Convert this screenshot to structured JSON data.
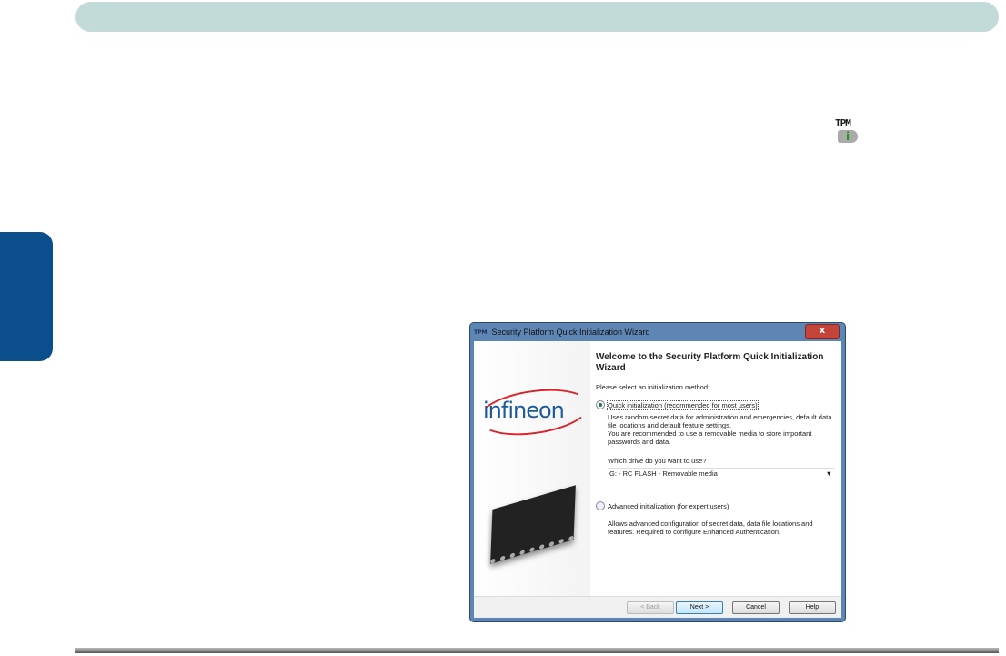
{
  "tpm_icon": {
    "label": "TPM",
    "glyph": "i"
  },
  "dialog": {
    "title": "Security Platform Quick Initialization Wizard",
    "title_icon": "TPM",
    "close": "x",
    "logo": "infineon",
    "heading": "Welcome to the Security Platform Quick Initialization Wizard",
    "prompt": "Please select an initialization method:",
    "quick": {
      "label": "Quick initialization (recommended for most users)",
      "selected": true,
      "desc1": "Uses random secret data for administration and emergencies, default data file locations and default feature settings.",
      "desc2": "You are recommended to use a removable media to store important passwords and data."
    },
    "drive_label": "Which drive do you want to use?",
    "drive_value": "G: - RC FLASH - Removable media",
    "advanced": {
      "label": "Advanced initialization (for expert users)",
      "selected": false,
      "desc": "Allows advanced configuration of secret data, data file locations and features. Required to configure Enhanced Authentication."
    },
    "buttons": {
      "back": "< Back",
      "next": "Next >",
      "cancel": "Cancel",
      "help": "Help"
    }
  }
}
